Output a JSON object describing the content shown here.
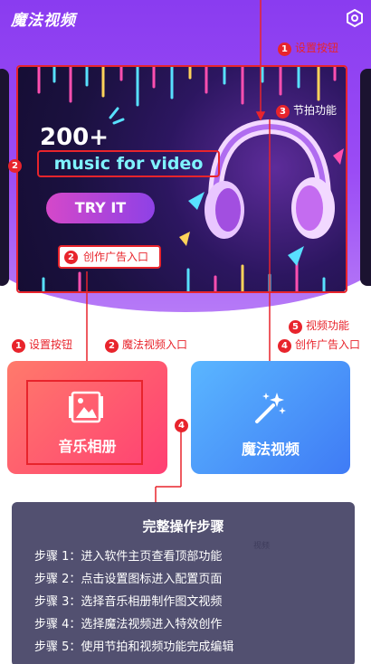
{
  "app": {
    "title": "魔法视频"
  },
  "banner": {
    "headline": "200+",
    "subline": "music for video",
    "cta": "TRY IT"
  },
  "annotations": {
    "settings_top": {
      "num": "1",
      "text": "设置按钮"
    },
    "beat": {
      "num": "3",
      "text": "节拍功能"
    },
    "music_video": {
      "num": "2"
    },
    "ad_entry_banner": {
      "num": "2",
      "text": "创作广告入口"
    },
    "video_function": {
      "num": "5",
      "text": "视频功能"
    },
    "ad_entry_right": {
      "num": "4",
      "text": "创作广告入口"
    },
    "settings_left": {
      "num": "1",
      "text": "设置按钮"
    },
    "magic_entry": {
      "num": "2",
      "text": "魔法视频入口"
    },
    "marker_4": {
      "num": "4"
    }
  },
  "cards": {
    "music": {
      "label": "音乐相册",
      "icon": "photo-album-icon"
    },
    "magic": {
      "label": "魔法视频",
      "icon": "magic-wand-icon"
    }
  },
  "tab_hint": "视频",
  "steps": {
    "title": "完整操作步骤",
    "items": [
      "步骤 1：进入软件主页查看顶部功能",
      "步骤 2：点击设置图标进入配置页面",
      "步骤 3：选择音乐相册制作图文视频",
      "步骤 4：选择魔法视频进入特效创作",
      "步骤 5：使用节拍和视频功能完成编辑"
    ]
  },
  "colors": {
    "accent_red": "#e8242c",
    "header_purple": "#8a3cf0",
    "card_music": "#ff4f72",
    "card_magic": "#4a8cf7"
  }
}
